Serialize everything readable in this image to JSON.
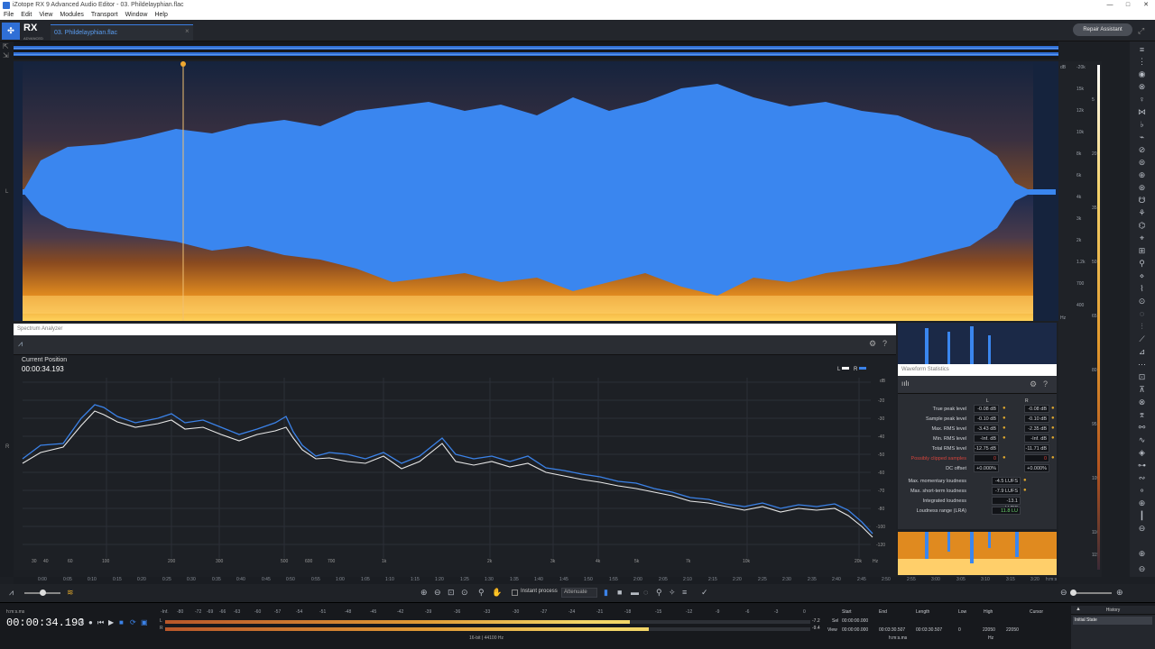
{
  "window": {
    "title": "iZotope RX 9 Advanced Audio Editor - 03. Phildelayphian.flac",
    "controls": [
      "—",
      "□",
      "✕"
    ]
  },
  "menu": [
    "File",
    "Edit",
    "View",
    "Modules",
    "Transport",
    "Window",
    "Help"
  ],
  "app": {
    "logo": "RX",
    "subtitle": "ADVANCED",
    "tab_label": "03. Phildelayphian.flac",
    "tab_close": "×",
    "repair_assistant": "Repair Assistant"
  },
  "channels": {
    "left": "L",
    "right": "R"
  },
  "right_scale": {
    "unit_db": "dB",
    "unit_hz": "Hz",
    "db_ticks": [
      "-20k",
      "-15k",
      "-12k",
      "-10k",
      "-8k",
      "-7k",
      "-6k",
      "-5k",
      "-4k",
      "-3.5k",
      "-3k",
      "-2.5k",
      "-2k",
      "-1.5k",
      "-1.2k",
      "-1k",
      "-900",
      "-800",
      "-700",
      "-600",
      "-500",
      "-400",
      "-300",
      "-200",
      "-100"
    ],
    "right_ticks": [
      "-20k",
      "15k",
      "12k",
      "10k",
      "8k",
      "7k",
      "6k",
      "5k",
      "4k",
      "3.5k",
      "3k",
      "2.5k",
      "2k",
      "1.5k",
      "1.2k",
      "1k",
      "900",
      "800",
      "700",
      "600",
      "500",
      "400",
      "300",
      "200"
    ],
    "meter_db": [
      "0",
      "5",
      "10",
      "15",
      "20",
      "25",
      "30",
      "35",
      "40",
      "45",
      "50",
      "55",
      "60",
      "65",
      "70",
      "75",
      "80",
      "85",
      "90",
      "95",
      "100",
      "105",
      "110",
      "115",
      "120"
    ]
  },
  "spectrum_analyzer": {
    "title": "Spectrum Analyzer",
    "current_position_label": "Current Position",
    "current_position": "00:00:34.193",
    "legend": [
      {
        "label": "L",
        "color": "#ffffff"
      },
      {
        "label": "R",
        "color": "#3b82e8"
      }
    ],
    "y_ticks": [
      "dB",
      "-10",
      "-20",
      "-30",
      "-40",
      "-50",
      "-60",
      "-70",
      "-80",
      "-90",
      "-100",
      "-110",
      "-120"
    ],
    "x_ticks": [
      "30",
      "40",
      "60",
      "100",
      "200",
      "300",
      "500",
      "600",
      "700",
      "1k",
      "2k",
      "3k",
      "4k",
      "5k",
      "7k",
      "10k",
      "20k"
    ],
    "x_unit": "Hz"
  },
  "waveform_statistics": {
    "title": "Waveform Statistics",
    "col_l": "L",
    "col_r": "R",
    "rows": [
      {
        "label": "True peak level",
        "l": "-0.08 dB",
        "r": "-0.08 dB"
      },
      {
        "label": "Sample peak level",
        "l": "-0.10 dB",
        "r": "-0.10 dB"
      },
      {
        "label": "Max. RMS level",
        "l": "-3.43 dB",
        "r": "-2.35 dB"
      },
      {
        "label": "Min. RMS level",
        "l": "-Inf. dB",
        "r": "-Inf. dB"
      },
      {
        "label": "Total RMS level",
        "l": "-12.75 dB",
        "r": "-11.71 dB"
      },
      {
        "label": "Possibly clipped samples",
        "l": "0",
        "r": "0"
      },
      {
        "label": "DC offset",
        "l": "+0.000%",
        "r": "+0.000%"
      }
    ],
    "loudness": [
      {
        "label": "Max. momentary loudness",
        "value": "-4.5 LUFS"
      },
      {
        "label": "Max. short-term loudness",
        "value": "-7.9 LUFS"
      },
      {
        "label": "Integrated loudness",
        "value": "-13.1 LUFS"
      },
      {
        "label": "Loudness range (LRA)",
        "value": "11.8 LU"
      }
    ]
  },
  "timeline": {
    "labels": [
      "0:00",
      "0:05",
      "0:10",
      "0:15",
      "0:20",
      "0:25",
      "0:30",
      "0:35",
      "0:40",
      "0:45",
      "0:50",
      "0:55",
      "1:00",
      "1:05",
      "1:10",
      "1:15",
      "1:20",
      "1:25",
      "1:30",
      "1:35",
      "1:40",
      "1:45",
      "1:50",
      "1:55",
      "2:00",
      "2:05",
      "2:10",
      "2:15",
      "2:20",
      "2:25",
      "2:30",
      "2:35",
      "2:40",
      "2:45",
      "2:50",
      "2:55",
      "3:00",
      "3:05",
      "3:10",
      "3:15",
      "3:20",
      "3:25"
    ],
    "unit": "h:m:s"
  },
  "toolbar": {
    "instant_process": "Instant process",
    "attenuate": "Attenuate"
  },
  "transport": {
    "time": "00:00:34.193",
    "time_format": "h:m:s.ms",
    "meter_ticks": [
      "-Inf.",
      "-80",
      "-72",
      "-69",
      "-66",
      "-63",
      "-60",
      "-57",
      "-54",
      "-51",
      "-48",
      "-45",
      "-42",
      "-39",
      "-36",
      "-33",
      "-30",
      "-27",
      "-24",
      "-21",
      "-18",
      "-15",
      "-12",
      "-9",
      "-6",
      "-3",
      "0"
    ],
    "meter_l_peak": "-7.2",
    "meter_r_peak": "-9.4",
    "meter_l_level": 0.72,
    "meter_r_level": 0.75,
    "format": "16-bit | 44100 Hz"
  },
  "selection": {
    "headers": [
      "Start",
      "End",
      "Length",
      "Low",
      "High",
      "Cursor"
    ],
    "sel_label": "Sel",
    "view_label": "View",
    "sel": {
      "start": "00:00:00.000",
      "end": "",
      "length": "",
      "low": "",
      "high": "",
      "cursor": ""
    },
    "view": {
      "start": "00:00:00.000",
      "end": "00:03:30.507",
      "length": "00:03:30.507",
      "low": "0",
      "high": "22050",
      "cursor": "22050"
    },
    "unit_time": "h:m:s.ms",
    "unit_hz": "Hz"
  },
  "history": {
    "title": "History",
    "items": [
      "Initial State"
    ]
  }
}
